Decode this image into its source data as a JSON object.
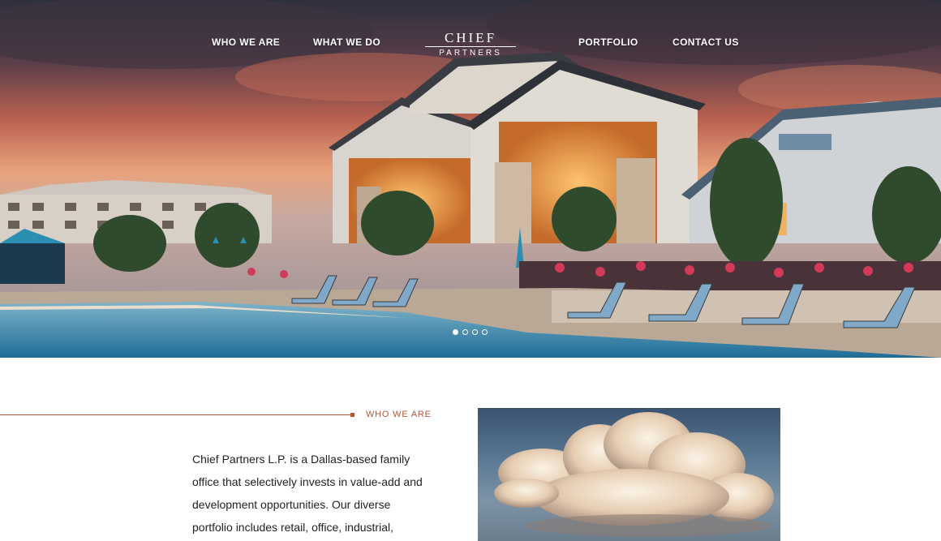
{
  "nav": {
    "left_links": [
      "WHO WE ARE",
      "WHAT WE DO"
    ],
    "right_links": [
      "PORTFOLIO",
      "CONTACT US"
    ],
    "logo_top": "CHIEF",
    "logo_bottom": "PARTNERS"
  },
  "hero": {
    "slide_count": 4,
    "active_slide": 1
  },
  "section": {
    "label": "WHO WE ARE",
    "lines": [
      "Chief Partners L.P. is a Dallas-based family",
      "office that selectively invests in value-add and",
      "development opportunities. Our diverse",
      "portfolio includes retail, office, industrial,"
    ]
  },
  "colors": {
    "accent": "#b0583a",
    "text": "#222222"
  }
}
